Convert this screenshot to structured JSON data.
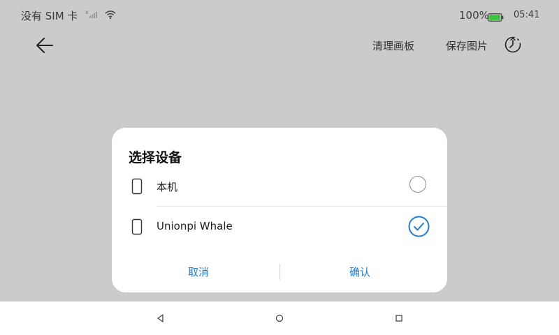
{
  "status_bar": {
    "carrier": "没有 SIM 卡",
    "battery_pct": "100%",
    "time": "05:41",
    "battery_color": "#3cc43c"
  },
  "toolbar": {
    "back_icon": "arrow-left-icon",
    "clear_label": "清理画板",
    "save_label": "保存图片",
    "history_icon": "clock-history-icon"
  },
  "dialog": {
    "title": "选择设备",
    "devices": [
      {
        "label": "本机",
        "selected": false,
        "icon": "phone-icon"
      },
      {
        "label": "Unionpi Whale",
        "selected": true,
        "icon": "phone-icon"
      }
    ],
    "cancel_label": "取消",
    "confirm_label": "确认",
    "accent_color": "#1e7fd4"
  },
  "navbar": {
    "back_icon": "triangle-back-icon",
    "home_icon": "circle-home-icon",
    "recents_icon": "square-recents-icon"
  }
}
